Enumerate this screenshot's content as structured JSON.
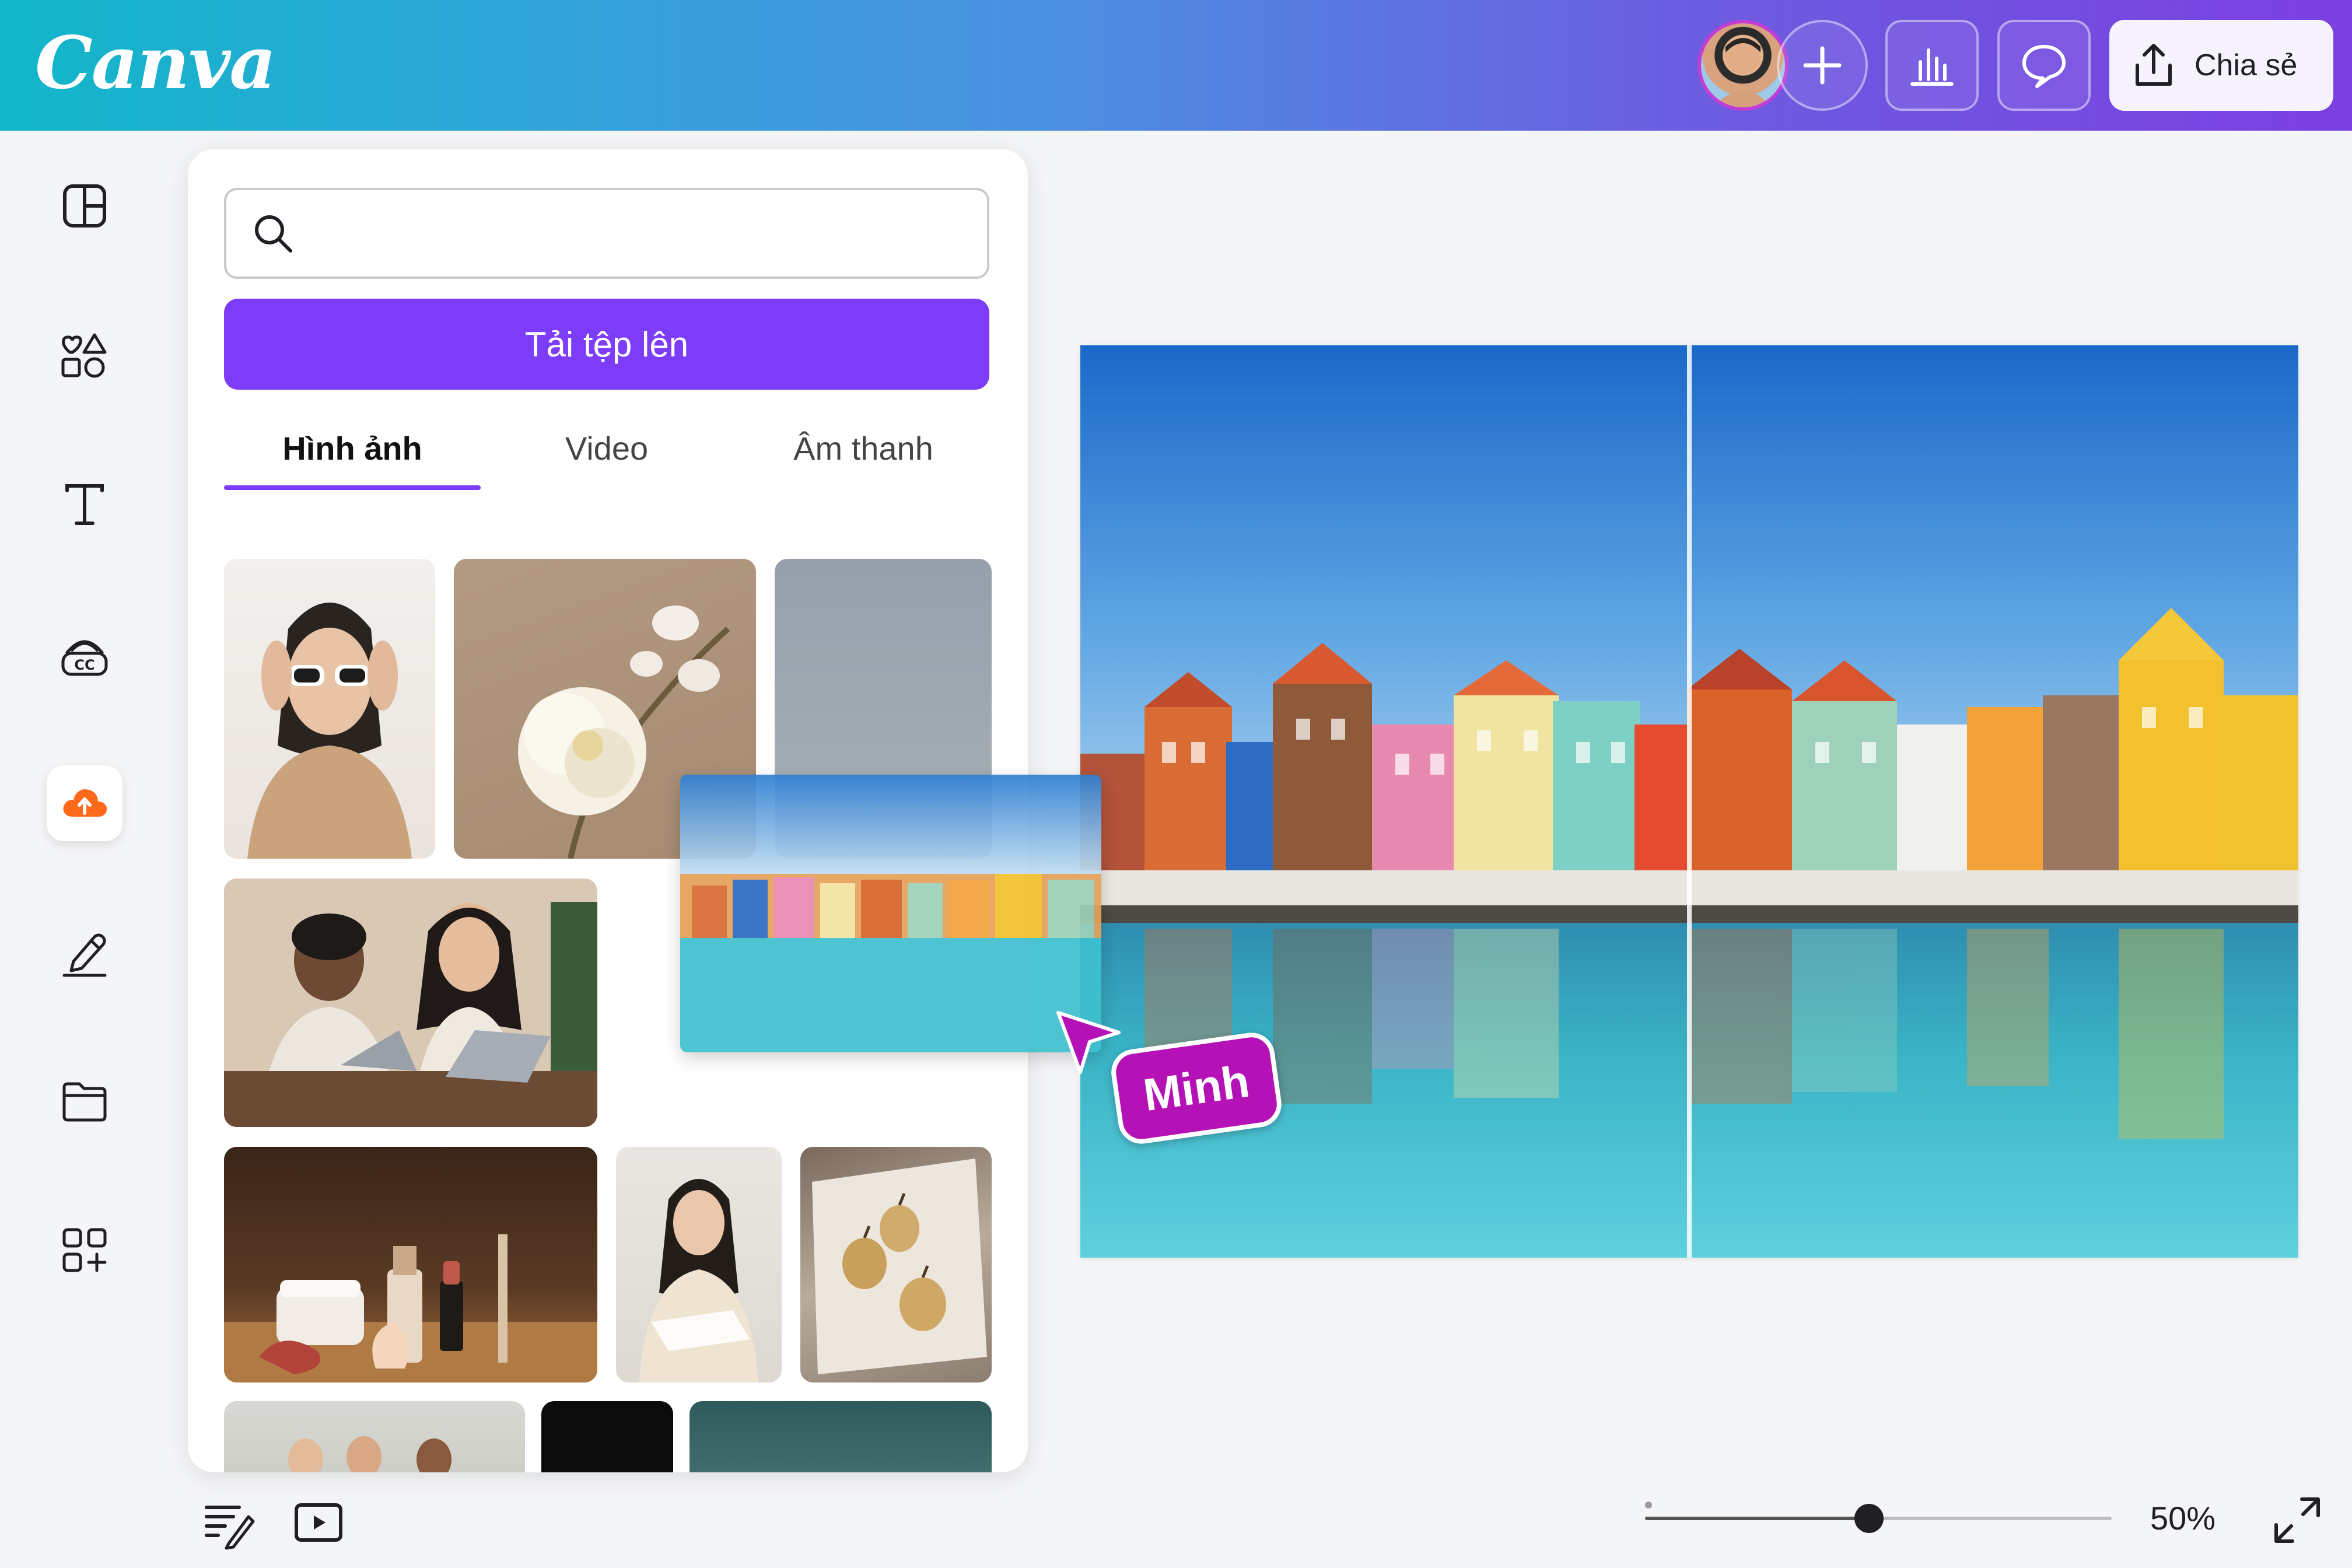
{
  "app": {
    "logo_text": "Canva"
  },
  "header": {
    "share_label": "Chia sẻ",
    "buttons": [
      "add-icon",
      "insights-icon",
      "comment-icon",
      "share-icon"
    ]
  },
  "sidebar": {
    "items": [
      {
        "icon": "layout-icon"
      },
      {
        "icon": "elements-icon"
      },
      {
        "icon": "text-icon"
      },
      {
        "icon": "brand-icon"
      },
      {
        "icon": "upload-icon",
        "active": true
      },
      {
        "icon": "draw-icon"
      },
      {
        "icon": "projects-icon"
      },
      {
        "icon": "apps-icon"
      }
    ]
  },
  "panel": {
    "search": {
      "placeholder": "",
      "value": ""
    },
    "upload_label": "Tải tệp lên",
    "tabs": [
      {
        "label": "Hình ảnh",
        "active": true
      },
      {
        "label": "Video"
      },
      {
        "label": "Âm thanh"
      }
    ]
  },
  "collaborator": {
    "name": "Minh"
  },
  "footer": {
    "zoom_label": "50%",
    "zoom_level": 0.48
  },
  "colors": {
    "accent": "#7d3cf7",
    "cursor": "#b412b7",
    "upload_icon": "#ff6a1a"
  }
}
